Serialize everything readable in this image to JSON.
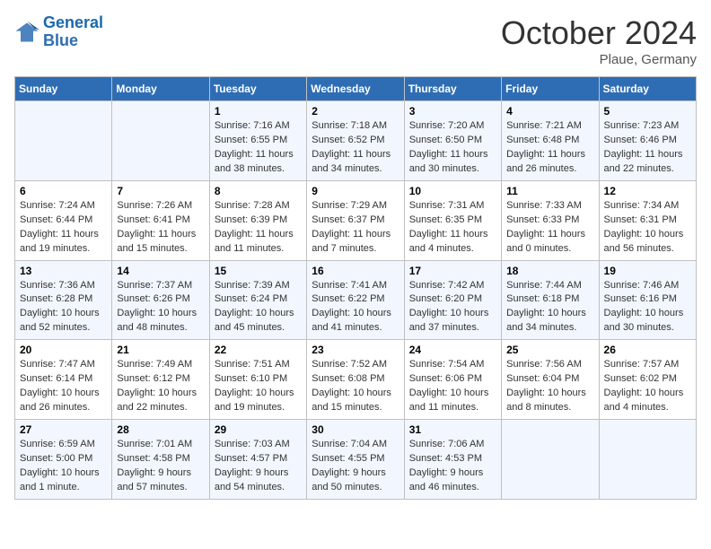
{
  "header": {
    "logo_general": "General",
    "logo_blue": "Blue",
    "month_title": "October 2024",
    "location": "Plaue, Germany"
  },
  "weekdays": [
    "Sunday",
    "Monday",
    "Tuesday",
    "Wednesday",
    "Thursday",
    "Friday",
    "Saturday"
  ],
  "weeks": [
    [
      {
        "day": "",
        "detail": ""
      },
      {
        "day": "",
        "detail": ""
      },
      {
        "day": "1",
        "detail": "Sunrise: 7:16 AM\nSunset: 6:55 PM\nDaylight: 11 hours and 38 minutes."
      },
      {
        "day": "2",
        "detail": "Sunrise: 7:18 AM\nSunset: 6:52 PM\nDaylight: 11 hours and 34 minutes."
      },
      {
        "day": "3",
        "detail": "Sunrise: 7:20 AM\nSunset: 6:50 PM\nDaylight: 11 hours and 30 minutes."
      },
      {
        "day": "4",
        "detail": "Sunrise: 7:21 AM\nSunset: 6:48 PM\nDaylight: 11 hours and 26 minutes."
      },
      {
        "day": "5",
        "detail": "Sunrise: 7:23 AM\nSunset: 6:46 PM\nDaylight: 11 hours and 22 minutes."
      }
    ],
    [
      {
        "day": "6",
        "detail": "Sunrise: 7:24 AM\nSunset: 6:44 PM\nDaylight: 11 hours and 19 minutes."
      },
      {
        "day": "7",
        "detail": "Sunrise: 7:26 AM\nSunset: 6:41 PM\nDaylight: 11 hours and 15 minutes."
      },
      {
        "day": "8",
        "detail": "Sunrise: 7:28 AM\nSunset: 6:39 PM\nDaylight: 11 hours and 11 minutes."
      },
      {
        "day": "9",
        "detail": "Sunrise: 7:29 AM\nSunset: 6:37 PM\nDaylight: 11 hours and 7 minutes."
      },
      {
        "day": "10",
        "detail": "Sunrise: 7:31 AM\nSunset: 6:35 PM\nDaylight: 11 hours and 4 minutes."
      },
      {
        "day": "11",
        "detail": "Sunrise: 7:33 AM\nSunset: 6:33 PM\nDaylight: 11 hours and 0 minutes."
      },
      {
        "day": "12",
        "detail": "Sunrise: 7:34 AM\nSunset: 6:31 PM\nDaylight: 10 hours and 56 minutes."
      }
    ],
    [
      {
        "day": "13",
        "detail": "Sunrise: 7:36 AM\nSunset: 6:28 PM\nDaylight: 10 hours and 52 minutes."
      },
      {
        "day": "14",
        "detail": "Sunrise: 7:37 AM\nSunset: 6:26 PM\nDaylight: 10 hours and 48 minutes."
      },
      {
        "day": "15",
        "detail": "Sunrise: 7:39 AM\nSunset: 6:24 PM\nDaylight: 10 hours and 45 minutes."
      },
      {
        "day": "16",
        "detail": "Sunrise: 7:41 AM\nSunset: 6:22 PM\nDaylight: 10 hours and 41 minutes."
      },
      {
        "day": "17",
        "detail": "Sunrise: 7:42 AM\nSunset: 6:20 PM\nDaylight: 10 hours and 37 minutes."
      },
      {
        "day": "18",
        "detail": "Sunrise: 7:44 AM\nSunset: 6:18 PM\nDaylight: 10 hours and 34 minutes."
      },
      {
        "day": "19",
        "detail": "Sunrise: 7:46 AM\nSunset: 6:16 PM\nDaylight: 10 hours and 30 minutes."
      }
    ],
    [
      {
        "day": "20",
        "detail": "Sunrise: 7:47 AM\nSunset: 6:14 PM\nDaylight: 10 hours and 26 minutes."
      },
      {
        "day": "21",
        "detail": "Sunrise: 7:49 AM\nSunset: 6:12 PM\nDaylight: 10 hours and 22 minutes."
      },
      {
        "day": "22",
        "detail": "Sunrise: 7:51 AM\nSunset: 6:10 PM\nDaylight: 10 hours and 19 minutes."
      },
      {
        "day": "23",
        "detail": "Sunrise: 7:52 AM\nSunset: 6:08 PM\nDaylight: 10 hours and 15 minutes."
      },
      {
        "day": "24",
        "detail": "Sunrise: 7:54 AM\nSunset: 6:06 PM\nDaylight: 10 hours and 11 minutes."
      },
      {
        "day": "25",
        "detail": "Sunrise: 7:56 AM\nSunset: 6:04 PM\nDaylight: 10 hours and 8 minutes."
      },
      {
        "day": "26",
        "detail": "Sunrise: 7:57 AM\nSunset: 6:02 PM\nDaylight: 10 hours and 4 minutes."
      }
    ],
    [
      {
        "day": "27",
        "detail": "Sunrise: 6:59 AM\nSunset: 5:00 PM\nDaylight: 10 hours and 1 minute."
      },
      {
        "day": "28",
        "detail": "Sunrise: 7:01 AM\nSunset: 4:58 PM\nDaylight: 9 hours and 57 minutes."
      },
      {
        "day": "29",
        "detail": "Sunrise: 7:03 AM\nSunset: 4:57 PM\nDaylight: 9 hours and 54 minutes."
      },
      {
        "day": "30",
        "detail": "Sunrise: 7:04 AM\nSunset: 4:55 PM\nDaylight: 9 hours and 50 minutes."
      },
      {
        "day": "31",
        "detail": "Sunrise: 7:06 AM\nSunset: 4:53 PM\nDaylight: 9 hours and 46 minutes."
      },
      {
        "day": "",
        "detail": ""
      },
      {
        "day": "",
        "detail": ""
      }
    ]
  ]
}
